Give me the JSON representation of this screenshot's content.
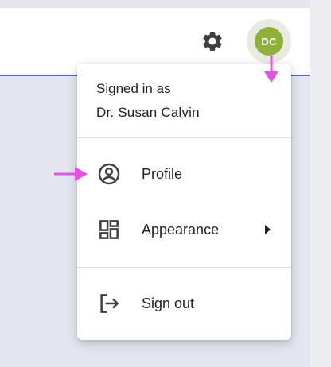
{
  "header": {
    "settings_icon": "gear-icon",
    "avatar_initials": "DC",
    "avatar_color": "#8fb236",
    "accent_color": "#3f6fe0"
  },
  "account_menu": {
    "signed_in_label": "Signed in as",
    "user_name": "Dr. Susan Calvin",
    "items": [
      {
        "label": "Profile",
        "icon": "account-circle-icon"
      },
      {
        "label": "Appearance",
        "icon": "dashboard-layout-icon",
        "has_submenu": true
      },
      {
        "label": "Sign out",
        "icon": "logout-icon"
      }
    ]
  },
  "annotations": {
    "pointer_color": "#e84fe8"
  }
}
